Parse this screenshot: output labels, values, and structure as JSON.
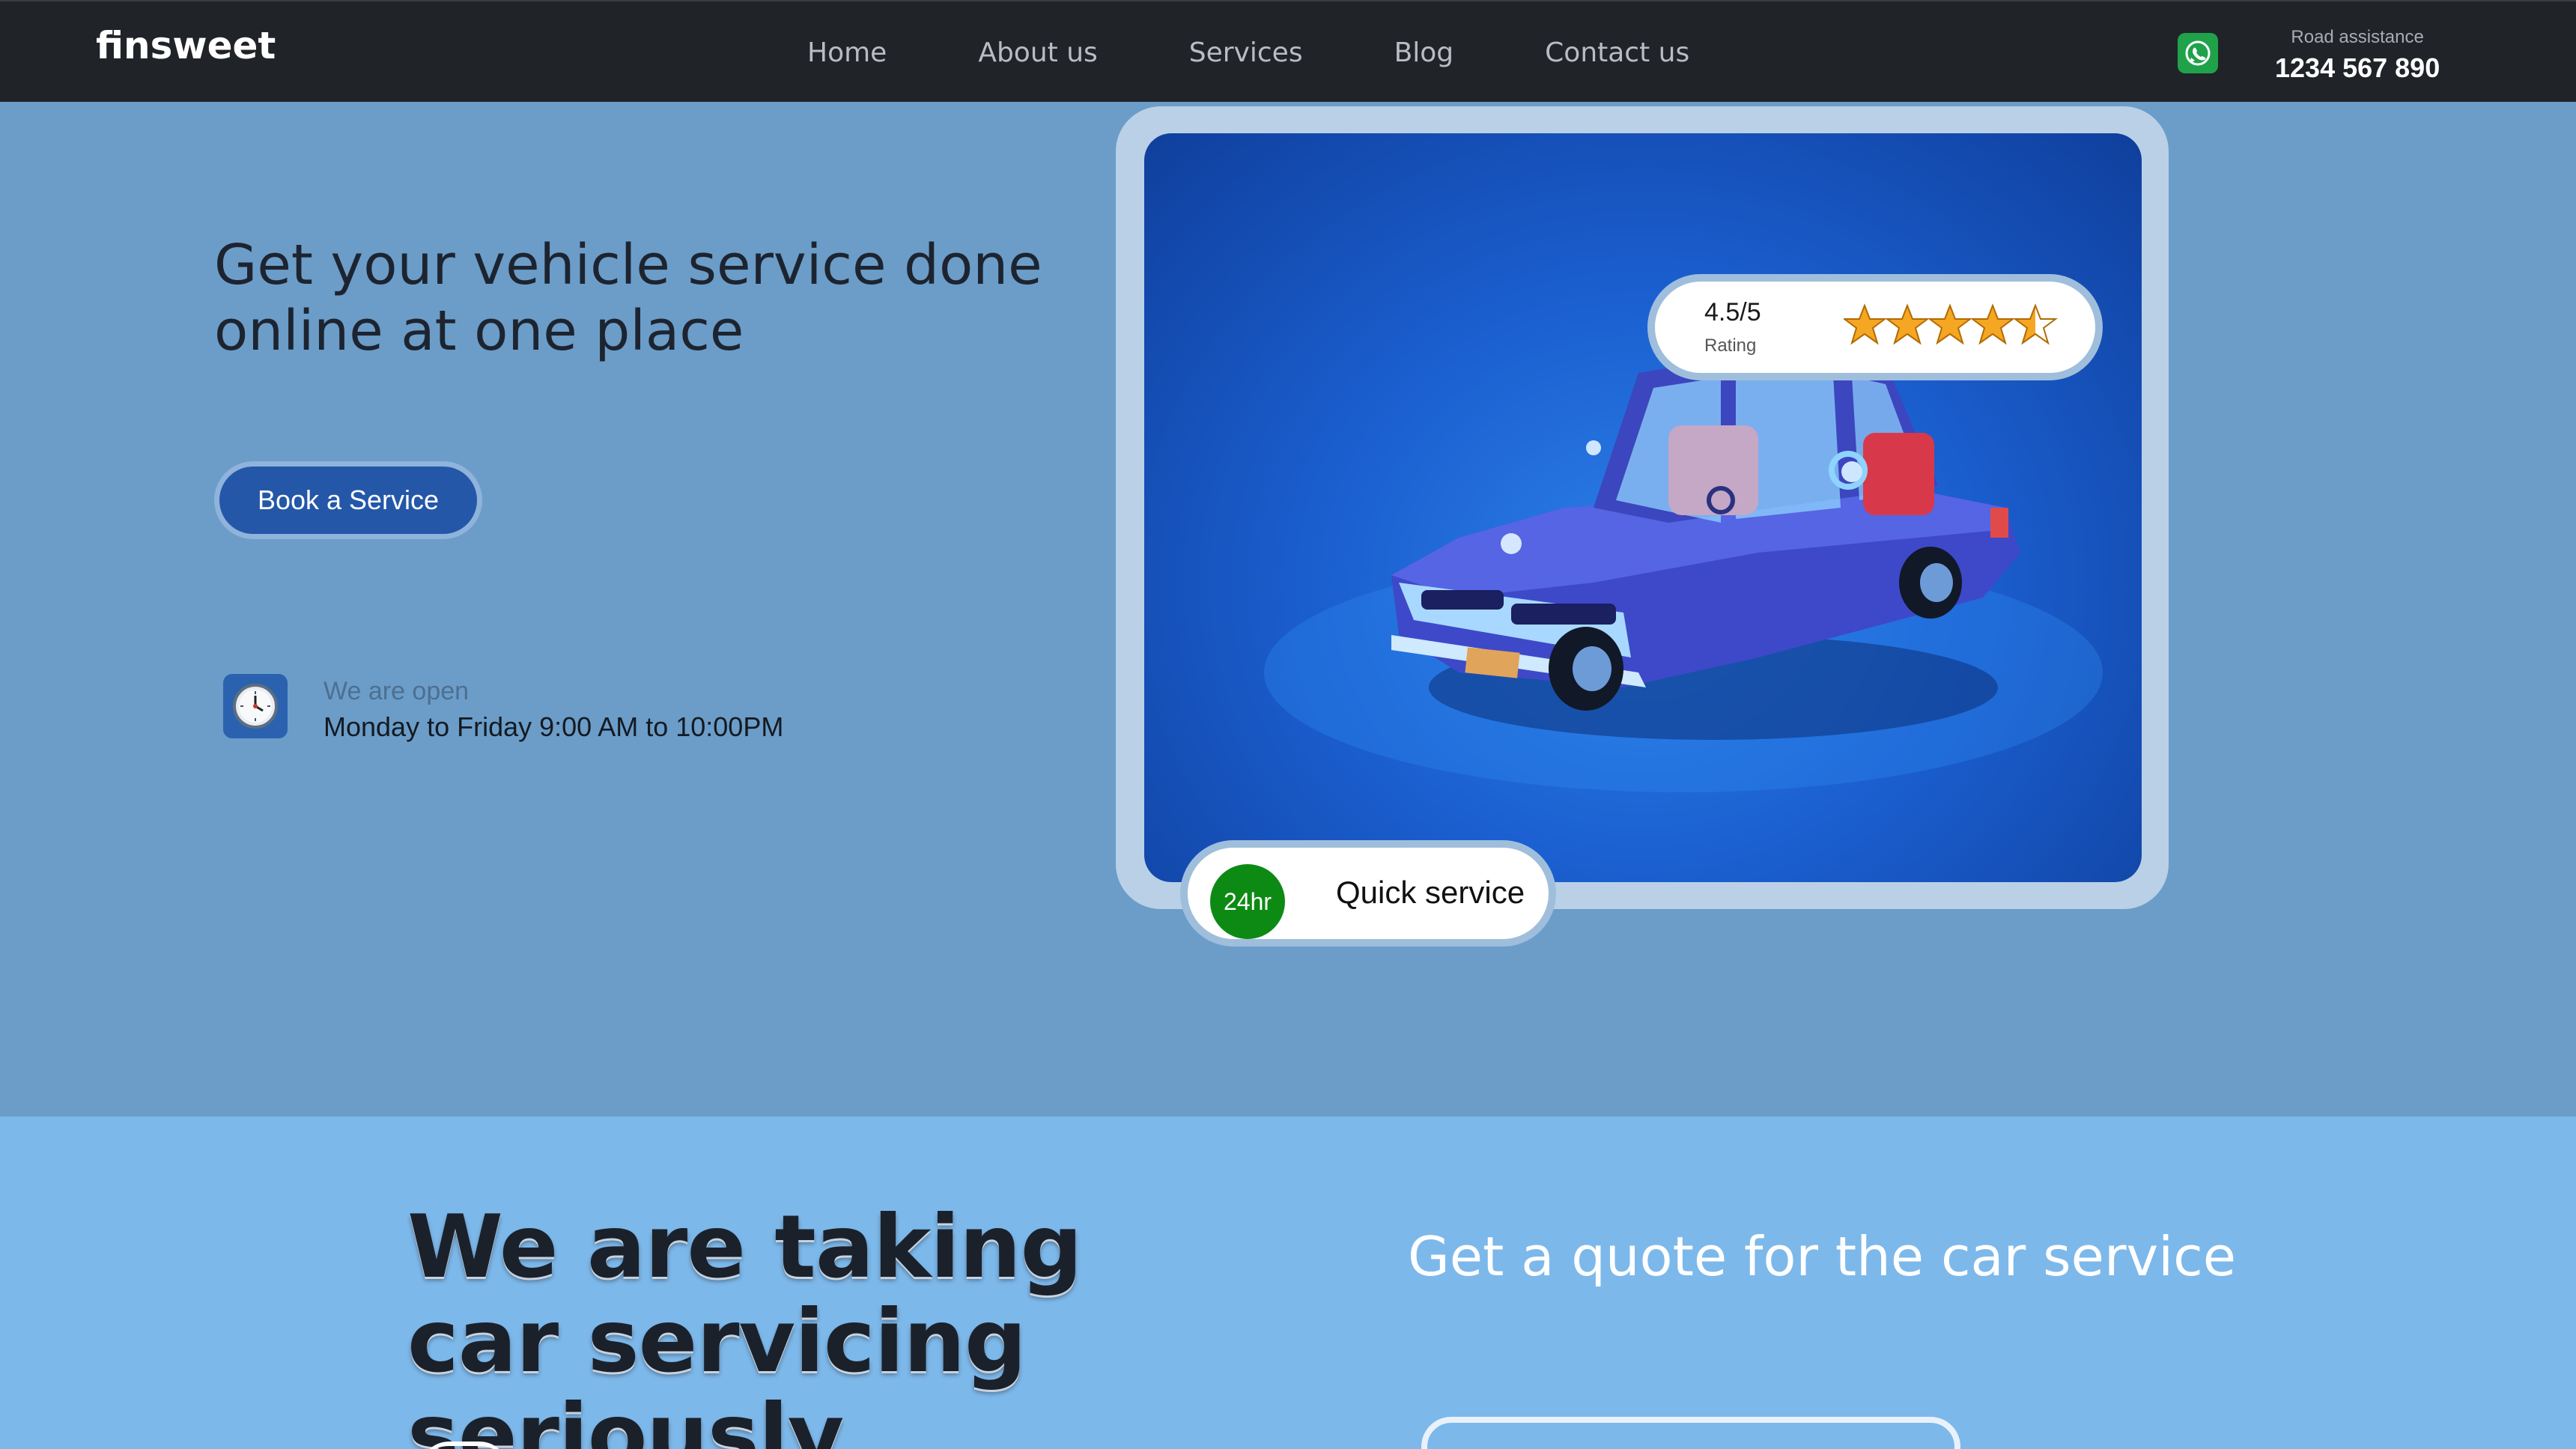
{
  "nav": {
    "logo": "finsweet",
    "links": [
      "Home",
      "About us",
      "Services",
      "Blog",
      "Contact us"
    ],
    "road_label": "Road assistance",
    "road_phone": "1234 567 890"
  },
  "hero": {
    "title": "Get your vehicle service done online at one place",
    "button_label": "Book a Service",
    "open_label": "We are open",
    "open_hours": "Monday to Friday 9:00 AM to 10:00PM",
    "rating_value": "4.5/5",
    "rating_label": "Rating",
    "rating_stars": 4.5,
    "quick_badge": "24hr",
    "quick_text": "Quick service"
  },
  "section2": {
    "title": "We are taking car servicing seriously",
    "quote_title": "Get a quote for the car service"
  },
  "colors": {
    "nav_bg": "#202328",
    "hero_bg": "#6b9dc8",
    "section2_bg": "#7db8ea",
    "button_bg": "#2457a8",
    "badge_green": "#0d8a13",
    "star": "#f5a623"
  },
  "icons": [
    "whatsapp-icon",
    "clock-icon",
    "star-icon"
  ]
}
